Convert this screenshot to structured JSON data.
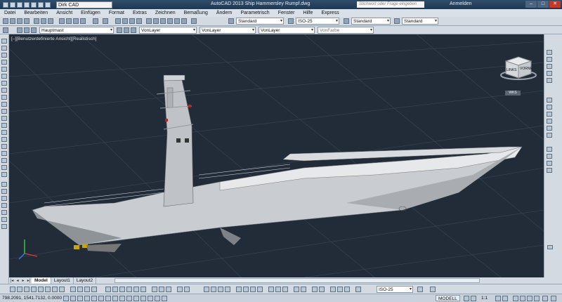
{
  "titlebar": {
    "workspace": "Dirk CAD",
    "title": "AutoCAD 2013    Ship Hammersley Rumpf.dwg",
    "search_placeholder": "Stichwort oder Frage eingeben",
    "signin": "Anmelden"
  },
  "menu": [
    "Datei",
    "Bearbeiten",
    "Ansicht",
    "Einfügen",
    "Format",
    "Extras",
    "Zeichnen",
    "Bemaßung",
    "Ändern",
    "Parametrisch",
    "Fenster",
    "Hilfe",
    "Express"
  ],
  "toolbar1": {
    "textstyle": "Standard",
    "dimstyle": "ISO-25",
    "tablestyle": "Standard",
    "mleaderstyle": "Standard"
  },
  "toolbar2": {
    "layer": "Hauptmast",
    "color": "VonLayer",
    "linetype": "VonLayer",
    "lineweight": "VonLayer",
    "plotstyle": "VonFarbe"
  },
  "viewport": {
    "label": "[–][Benutzerdefinierte Ansicht][Realistisch]",
    "viewcube_left": "LINKS",
    "viewcube_front": "VORNE",
    "wcs": "WKS"
  },
  "tabs": [
    "Model",
    "Layout1",
    "Layout2"
  ],
  "bottom": {
    "dimstyle": "ISO-25"
  },
  "status": {
    "coords": "798.2091, 1541.7132, 0.0000",
    "model": "MODELL",
    "scale": "1:1"
  },
  "colors": {
    "viewport_bg": "#212c38",
    "grid": "#3a4654",
    "hull": "#c9ccd0",
    "hull_dark": "#8e9398",
    "titlebar": "#2f4d6b"
  }
}
